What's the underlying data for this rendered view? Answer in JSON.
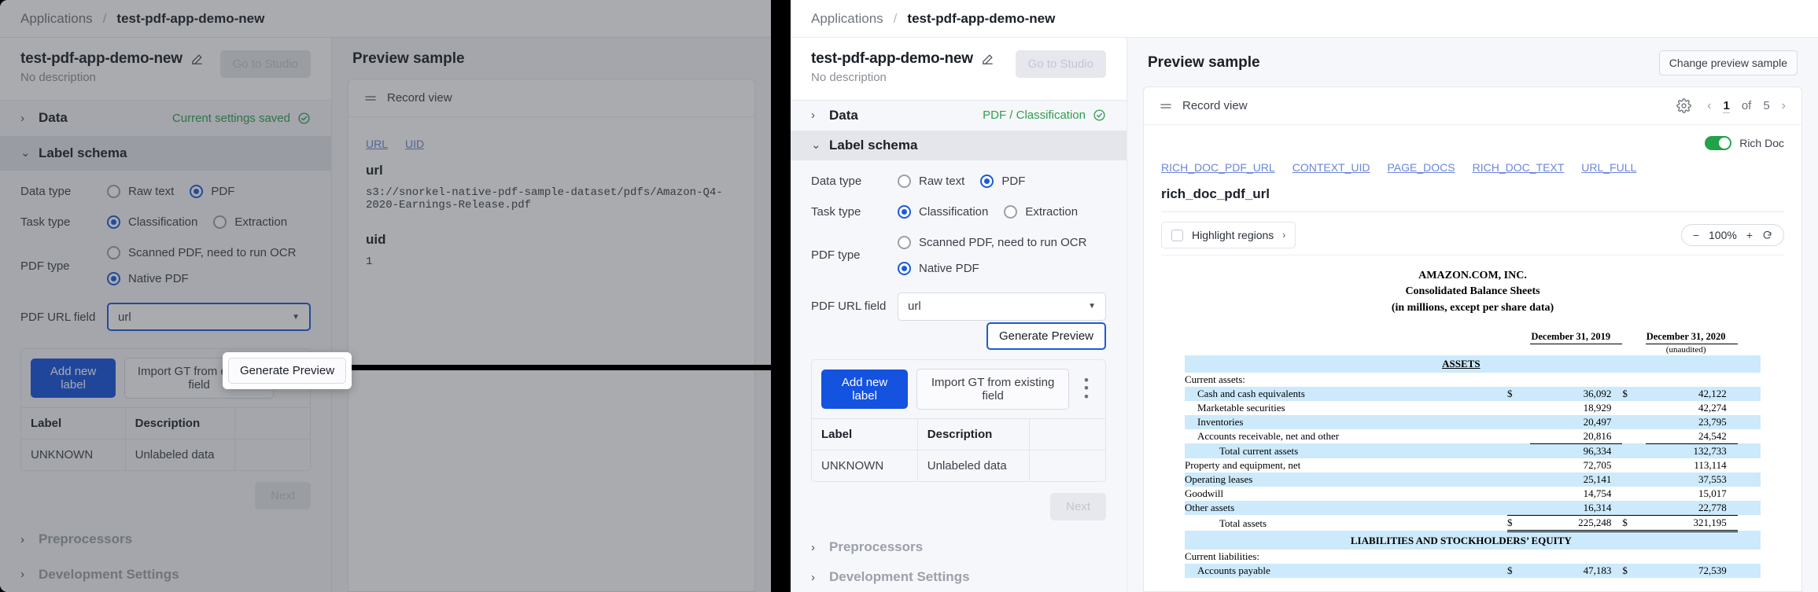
{
  "breadcrumb": {
    "root": "Applications",
    "separator": "/",
    "current": "test-pdf-app-demo-new"
  },
  "app_header": {
    "title": "test-pdf-app-demo-new",
    "description": "No description",
    "studio_button": "Go to Studio",
    "edit_icon": "pencil-icon"
  },
  "sections": {
    "data_label": "Data",
    "data_status_before": "Current settings saved",
    "data_status_after": "PDF / Classification",
    "label_schema_label": "Label schema",
    "preprocessors_label": "Preprocessors",
    "development_settings_label": "Development Settings"
  },
  "schema_form": {
    "data_type": {
      "label": "Data type",
      "options": [
        {
          "label": "Raw text",
          "selected": false
        },
        {
          "label": "PDF",
          "selected": true
        }
      ]
    },
    "task_type": {
      "label": "Task type",
      "options": [
        {
          "label": "Classification",
          "selected": true
        },
        {
          "label": "Extraction",
          "selected": false
        }
      ]
    },
    "pdf_type": {
      "label": "PDF type",
      "options": [
        {
          "label": "Scanned PDF, need to run OCR",
          "selected": false
        },
        {
          "label": "Native PDF",
          "selected": true
        }
      ]
    },
    "pdf_url_field": {
      "label": "PDF URL field",
      "value": "url"
    },
    "generate_preview_button": "Generate Preview"
  },
  "label_card": {
    "add_new_label": "Add new label",
    "import_gt": "Import GT from existing field",
    "overflow_icon": "kebab-menu-icon",
    "columns": [
      "Label",
      "Description"
    ],
    "rows": [
      {
        "label": "UNKNOWN",
        "description": "Unlabeled data"
      }
    ],
    "next_button": "Next"
  },
  "preview": {
    "title": "Preview sample",
    "change_button": "Change preview sample",
    "record_view_label": "Record view",
    "settings_icon": "gear-icon",
    "pager": {
      "prev": "‹",
      "current": "1",
      "of": "of",
      "total": "5",
      "next": "›"
    },
    "rich_doc_toggle_label": "Rich Doc",
    "rich_doc_toggle_on": true
  },
  "preview_before": {
    "field_tabs": [
      "URL",
      "UID"
    ],
    "fields": [
      {
        "name": "url",
        "value": "s3://snorkel-native-pdf-sample-dataset/pdfs/Amazon-Q4-2020-Earnings-Release.pdf"
      },
      {
        "name": "uid",
        "value": "1"
      }
    ]
  },
  "preview_after": {
    "field_tabs": [
      "RICH_DOC_PDF_URL",
      "CONTEXT_UID",
      "PAGE_DOCS",
      "RICH_DOC_TEXT",
      "URL_FULL"
    ],
    "field_name": "rich_doc_pdf_url",
    "highlight_regions_label": "Highlight regions",
    "highlight_regions_checked": false,
    "zoom": {
      "minus": "−",
      "level": "100%",
      "plus": "+",
      "reset_icon": "reset-icon"
    }
  },
  "tooltip": {
    "text": "Generate Preview"
  },
  "colors": {
    "accent_blue": "#1452e0",
    "focus_blue": "#1a5bdb",
    "success_green": "#2e9e4f",
    "toggle_green": "#22a34a",
    "link_blue": "#6b86d8",
    "highlight_band": "#cceafb"
  },
  "document": {
    "company": "AMAZON.COM, INC.",
    "statement": "Consolidated Balance Sheets",
    "units": "(in millions, except per share data)",
    "col_headers": [
      "December 31, 2019",
      "December 31, 2020"
    ],
    "col_subheader": "(unaudited)",
    "assets_heading": "ASSETS",
    "liabilities_heading": "LIABILITIES AND STOCKHOLDERS’ EQUITY",
    "rows": [
      {
        "label": "Current assets:",
        "indent": 0,
        "v1": "",
        "v2": "",
        "cur": false,
        "band": false,
        "rule": false
      },
      {
        "label": "Cash and cash equivalents",
        "indent": 1,
        "v1": "36,092",
        "v2": "42,122",
        "cur": true,
        "band": true,
        "rule": false
      },
      {
        "label": "Marketable securities",
        "indent": 1,
        "v1": "18,929",
        "v2": "42,274",
        "cur": false,
        "band": false,
        "rule": false
      },
      {
        "label": "Inventories",
        "indent": 1,
        "v1": "20,497",
        "v2": "23,795",
        "cur": false,
        "band": true,
        "rule": false
      },
      {
        "label": "Accounts receivable, net and other",
        "indent": 1,
        "v1": "20,816",
        "v2": "24,542",
        "cur": false,
        "band": false,
        "rule": "under"
      },
      {
        "label": "Total current assets",
        "indent": 2,
        "v1": "96,334",
        "v2": "132,733",
        "cur": false,
        "band": true,
        "rule": false
      },
      {
        "label": "Property and equipment, net",
        "indent": 0,
        "v1": "72,705",
        "v2": "113,114",
        "cur": false,
        "band": false,
        "rule": false
      },
      {
        "label": "Operating leases",
        "indent": 0,
        "v1": "25,141",
        "v2": "37,553",
        "cur": false,
        "band": true,
        "rule": false
      },
      {
        "label": "Goodwill",
        "indent": 0,
        "v1": "14,754",
        "v2": "15,017",
        "cur": false,
        "band": false,
        "rule": false
      },
      {
        "label": "Other assets",
        "indent": 0,
        "v1": "16,314",
        "v2": "22,778",
        "cur": false,
        "band": true,
        "rule": "under"
      },
      {
        "label": "Total assets",
        "indent": 2,
        "v1": "225,248",
        "v2": "321,195",
        "cur": true,
        "band": false,
        "rule": "double"
      },
      {
        "label": "Current liabilities:",
        "indent": 0,
        "v1": "",
        "v2": "",
        "cur": false,
        "band": false,
        "rule": false
      },
      {
        "label": "Accounts payable",
        "indent": 1,
        "v1": "47,183",
        "v2": "72,539",
        "cur": true,
        "band": true,
        "rule": false
      }
    ]
  }
}
